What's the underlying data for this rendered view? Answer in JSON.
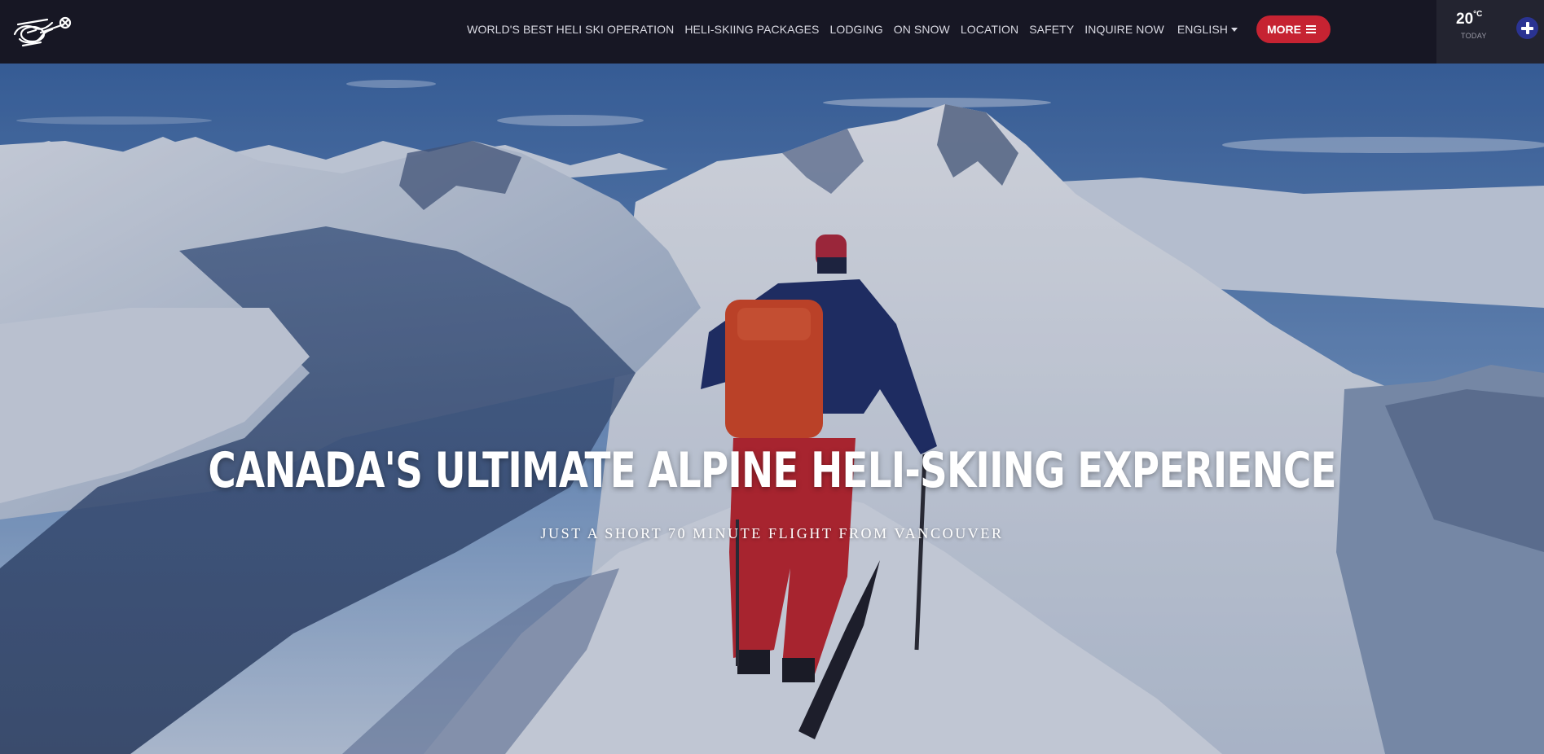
{
  "nav": {
    "items": [
      {
        "label": "WORLD'S BEST HELI SKI OPERATION",
        "name": "nav-item-best-operation"
      },
      {
        "label": "HELI-SKIING PACKAGES",
        "name": "nav-item-packages"
      },
      {
        "label": "LODGING",
        "name": "nav-item-lodging"
      },
      {
        "label": "ON SNOW",
        "name": "nav-item-on-snow"
      },
      {
        "label": "LOCATION",
        "name": "nav-item-location"
      },
      {
        "label": "SAFETY",
        "name": "nav-item-safety"
      },
      {
        "label": "INQUIRE NOW",
        "name": "nav-item-inquire-now"
      }
    ],
    "language": "ENGLISH",
    "more_label": "MORE"
  },
  "weather": {
    "temperature": "20",
    "unit": "°C",
    "label": "TODAY"
  },
  "hero": {
    "headline": "CANADA'S ULTIMATE ALPINE HELI-SKIING EXPERIENCE",
    "subheadline": "JUST A SHORT 70 MINUTE FLIGHT FROM VANCOUVER"
  },
  "colors": {
    "topbar_bg": "#171724",
    "more_button": "#c62332",
    "plus_button": "#2a3392"
  },
  "icons": {
    "logo": "helicopter-logo",
    "more": "menu-icon",
    "language": "caret-down-icon",
    "plus": "plus-icon"
  }
}
